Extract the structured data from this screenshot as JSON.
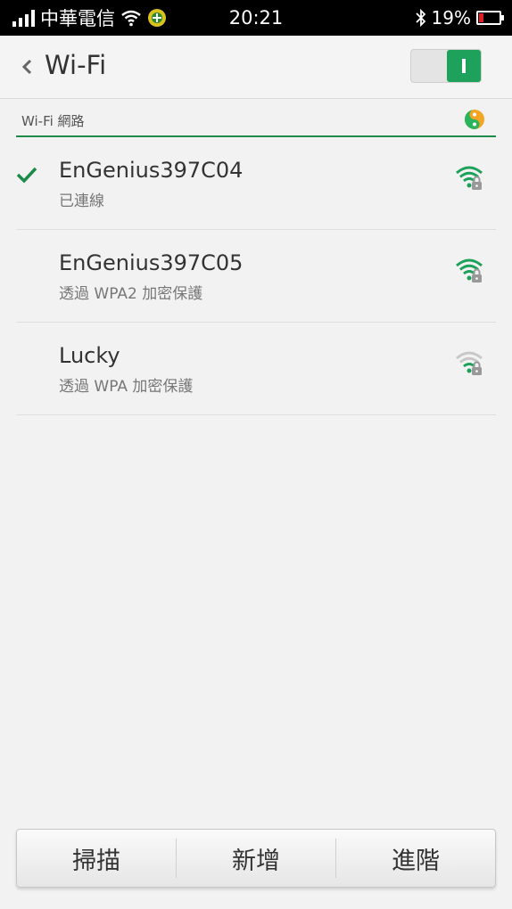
{
  "status_bar": {
    "carrier": "中華電信",
    "time": "20:21",
    "battery_percent": "19%"
  },
  "header": {
    "back_icon": "chevron-left-icon",
    "title": "Wi-Fi",
    "wifi_enabled": true,
    "toggle_on_label": "I"
  },
  "section": {
    "label": "Wi-Fi 網路"
  },
  "networks": [
    {
      "name": "EnGenius397C04",
      "status": "已連線",
      "connected": true,
      "signal": "strong",
      "secured": true
    },
    {
      "name": "EnGenius397C05",
      "status": "透過 WPA2 加密保護",
      "connected": false,
      "signal": "strong",
      "secured": true
    },
    {
      "name": "Lucky",
      "status": "透過 WPA 加密保護",
      "connected": false,
      "signal": "weak",
      "secured": true
    }
  ],
  "buttons": {
    "scan": "掃描",
    "add": "新增",
    "advanced": "進階"
  },
  "colors": {
    "accent": "#1ea15a",
    "battery_low": "#e02020"
  }
}
